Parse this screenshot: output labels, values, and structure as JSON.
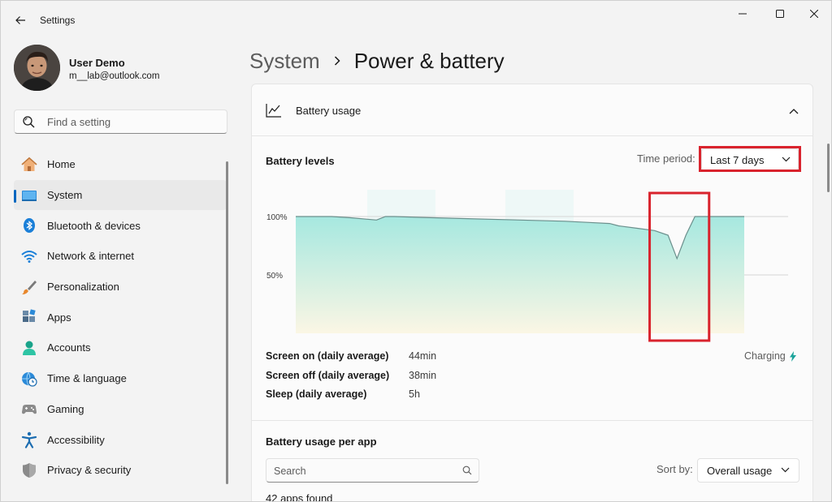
{
  "window": {
    "title": "Settings"
  },
  "profile": {
    "name": "User Demo",
    "email": "m__lab@outlook.com"
  },
  "search": {
    "placeholder": "Find a setting"
  },
  "nav": {
    "items": [
      {
        "label": "Home",
        "icon": "home-icon"
      },
      {
        "label": "System",
        "icon": "monitor-icon",
        "active": true
      },
      {
        "label": "Bluetooth & devices",
        "icon": "bluetooth-icon"
      },
      {
        "label": "Network & internet",
        "icon": "wifi-icon"
      },
      {
        "label": "Personalization",
        "icon": "brush-icon"
      },
      {
        "label": "Apps",
        "icon": "apps-icon"
      },
      {
        "label": "Accounts",
        "icon": "person-icon"
      },
      {
        "label": "Time & language",
        "icon": "globe-clock-icon"
      },
      {
        "label": "Gaming",
        "icon": "gamepad-icon"
      },
      {
        "label": "Accessibility",
        "icon": "accessibility-icon"
      },
      {
        "label": "Privacy & security",
        "icon": "shield-icon"
      }
    ]
  },
  "breadcrumb": {
    "parent": "System",
    "current": "Power & battery"
  },
  "battery_usage": {
    "header": "Battery usage",
    "levels_title": "Battery levels",
    "time_period_label": "Time period:",
    "time_period_value": "Last 7 days",
    "stats": [
      {
        "label": "Screen on (daily average)",
        "value": "44min"
      },
      {
        "label": "Screen off (daily average)",
        "value": "38min"
      },
      {
        "label": "Sleep (daily average)",
        "value": "5h"
      }
    ],
    "charging_label": "Charging"
  },
  "per_app": {
    "title": "Battery usage per app",
    "search_placeholder": "Search",
    "sort_label": "Sort by:",
    "sort_value": "Overall usage",
    "apps_found": "42 apps found"
  },
  "colors": {
    "accent": "#0067c0",
    "highlight": "#d9232d",
    "chart_fill_top": "#a6e8e0",
    "chart_fill_bottom": "#fbf6e4",
    "chart_line": "#6b8f8c",
    "charging": "#1aa39a"
  },
  "chart_data": {
    "type": "area",
    "ylabel": "",
    "ytick_labels": [
      "100%",
      "50%"
    ],
    "ylim": [
      0,
      100
    ],
    "x": [
      0,
      0.08,
      0.12,
      0.18,
      0.2,
      0.22,
      0.3,
      0.4,
      0.5,
      0.6,
      0.65,
      0.7,
      0.72,
      0.76,
      0.8,
      0.83,
      0.85,
      0.87,
      0.89,
      0.9,
      0.92,
      0.95,
      1.0
    ],
    "series": [
      {
        "values": [
          100,
          100,
          99,
          97,
          100,
          100,
          99,
          98,
          97,
          96,
          95,
          94,
          92,
          90,
          88,
          84,
          64,
          84,
          100,
          100,
          100,
          100,
          100
        ]
      }
    ],
    "shaded_columns": [
      1,
      3
    ],
    "charging_highlight_range": [
      0.78,
      0.88
    ]
  }
}
